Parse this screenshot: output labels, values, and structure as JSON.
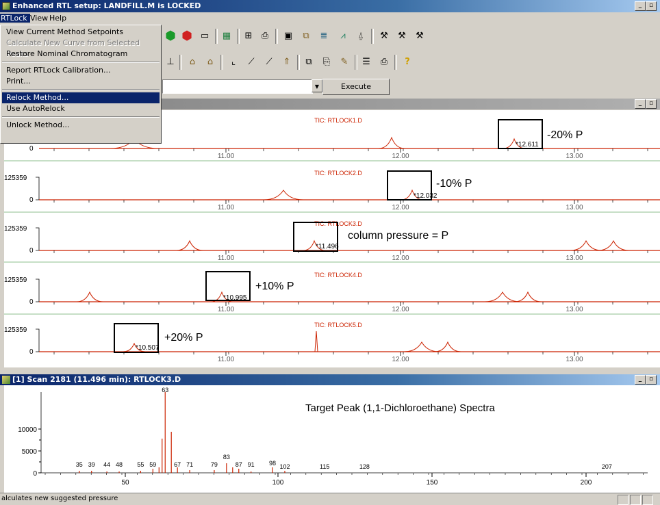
{
  "window": {
    "title": "Enhanced RTL setup: LANDFILL.M is LOCKED",
    "controls": [
      "_",
      "▫",
      "×"
    ]
  },
  "menubar": {
    "items": [
      "RTLock",
      "View",
      "Help"
    ]
  },
  "rtlock_menu": {
    "items": [
      {
        "label": "View Current Method Setpoints",
        "state": "enabled"
      },
      {
        "label": "Calculate New Curve from Selected Peaks",
        "state": "disabled"
      },
      {
        "label": "Restore Nominal Chromatogram",
        "state": "enabled"
      },
      {
        "label": "Report RTLock Calibration...",
        "state": "enabled"
      },
      {
        "label": "Print...",
        "state": "enabled"
      },
      {
        "label": "Relock Method...",
        "state": "selected"
      },
      {
        "label": "Use AutoRelock",
        "state": "enabled"
      },
      {
        "label": "Unlock Method...",
        "state": "enabled"
      }
    ]
  },
  "toolbar": {
    "execute_label": "Execute",
    "combo_value": ""
  },
  "chromatograms": {
    "y_max_label": "125359",
    "y_zero_label": "0",
    "x_ticks": [
      "11.00",
      "12.00",
      "13.00"
    ],
    "panels": [
      {
        "title": "TIC: RTLOCK1.D",
        "peak_label": "12.611",
        "annotation": "-20% P"
      },
      {
        "title": "TIC: RTLOCK2.D",
        "peak_label": "12.032",
        "annotation": "-10% P"
      },
      {
        "title": "TIC: RTLOCK3.D",
        "peak_label": "11.496",
        "annotation": "column pressure = P"
      },
      {
        "title": "TIC: RTLOCK4.D",
        "peak_label": "10.995",
        "annotation": "+10% P"
      },
      {
        "title": "TIC: RTLOCK5.D",
        "peak_label": "10.507",
        "annotation": "+20% P"
      }
    ]
  },
  "spectrum": {
    "window_title": "[1] Scan 2181 (11.496 min): RTLOCK3.D",
    "heading": "Target Peak (1,1-Dichloroethane) Spectra",
    "y_ticks": [
      "10000",
      "5000",
      "0"
    ],
    "x_ticks": [
      "50",
      "100",
      "150",
      "200"
    ],
    "peak_labels": [
      "35",
      "39",
      "44",
      "48",
      "55",
      "59",
      "63",
      "67",
      "71",
      "79",
      "83",
      "87",
      "91",
      "98",
      "102",
      "115",
      "128",
      "207"
    ]
  },
  "statusbar": {
    "text": "alculates new suggested pressure"
  },
  "colors": {
    "trace": "#cc2200",
    "title_active": "#0a246a",
    "menu_selected": "#0a246a"
  }
}
